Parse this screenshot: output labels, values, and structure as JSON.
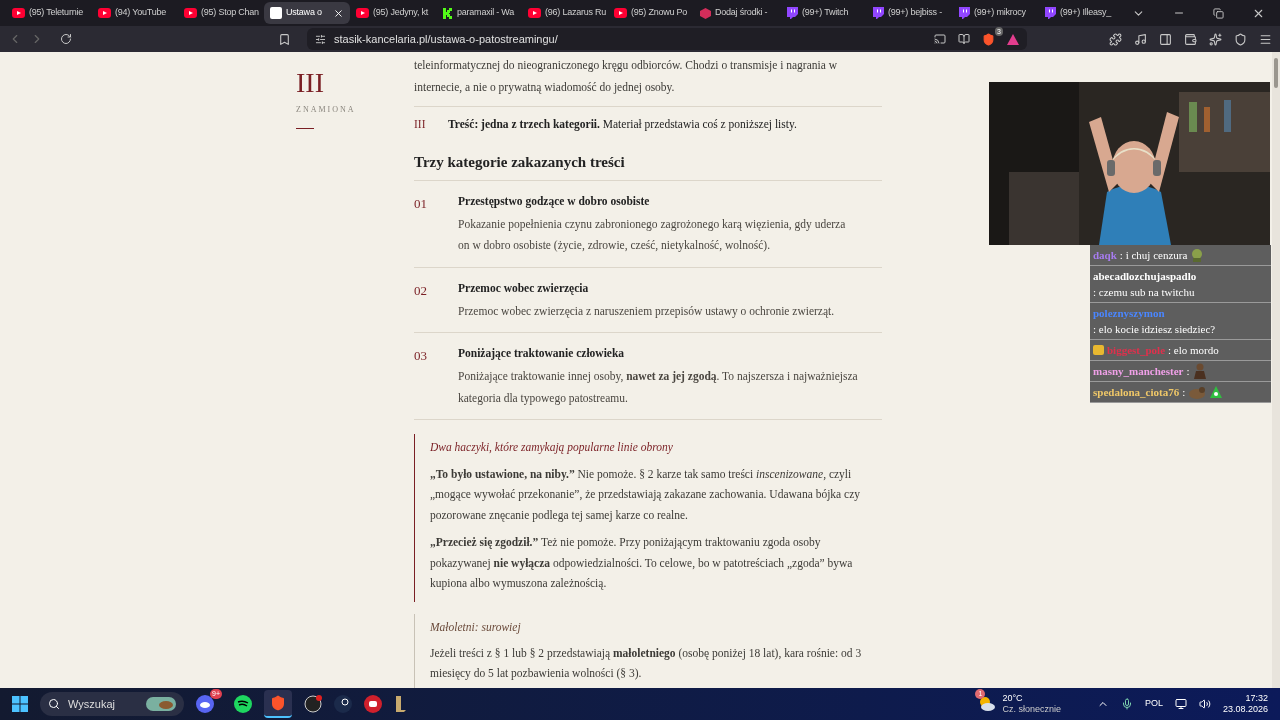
{
  "browser": {
    "tabs": [
      {
        "label": "(95) Teleturnie",
        "kind": "youtube",
        "selected": false
      },
      {
        "label": "(94) YouTube",
        "kind": "youtube",
        "selected": false
      },
      {
        "label": "(95) Stop Chan",
        "kind": "youtube",
        "selected": false
      },
      {
        "label": "Ustawa o",
        "kind": "page",
        "selected": true
      },
      {
        "label": "(95) Jedyny, kt",
        "kind": "youtube",
        "selected": false
      },
      {
        "label": "paramaxil - Wa",
        "kind": "kick",
        "selected": false
      },
      {
        "label": "(96) Lazarus Ru",
        "kind": "youtube",
        "selected": false
      },
      {
        "label": "(95) Znowu Po",
        "kind": "youtube",
        "selected": false
      },
      {
        "label": "Dodaj środki -",
        "kind": "wallet",
        "selected": false
      },
      {
        "label": "(99+) Twitch",
        "kind": "twitch",
        "selected": false
      },
      {
        "label": "(99+) bejbiss -",
        "kind": "twitch",
        "selected": false
      },
      {
        "label": "(99+) mikrocy",
        "kind": "twitch",
        "selected": false
      },
      {
        "label": "(99+) Illeasy_",
        "kind": "twitch",
        "selected": false
      }
    ],
    "url": "stasik-kancelaria.pl/ustawa-o-patostreamingu/",
    "shield_badge": "3"
  },
  "page": {
    "numeral": "III",
    "section_label": "ZNAMIONA",
    "intro": "teleinformatycznej do nieograniczonego kręgu odbiorców. Chodzi o transmisje i nagrania w internecie, a nie o prywatną wiadomość do jednej osoby.",
    "criterion": {
      "number": "III",
      "text": "**Treść: jedna z trzech kategorii.** Materiał przedstawia coś z poniższej listy."
    },
    "heading": "Trzy kategorie zakazanych treści",
    "categories": [
      {
        "number": "01",
        "title": "Przestępstwo godzące w dobro osobiste",
        "description": "Pokazanie popełnienia czynu zabronionego zagrożonego karą więzienia, gdy uderza on w dobro osobiste (życie, zdrowie, cześć, nietykalność, wolność)."
      },
      {
        "number": "02",
        "title": "Przemoc wobec zwierzęcia",
        "description": "Przemoc wobec zwierzęcia z naruszeniem przepisów ustawy o ochronie zwierząt."
      },
      {
        "number": "03",
        "title": "Poniżające traktowanie człowieka",
        "description": "Poniżające traktowanie innej osoby, **nawet za jej zgodą**. To najszersza i najważniejsza kategoria dla typowego patostreamu."
      }
    ],
    "callouts": [
      {
        "kind": "warning",
        "title": "Dwa haczyki, które zamykają popularne linie obrony",
        "paragraphs": [
          "**„To było ustawione, na niby.”** Nie pomoże. § 2 karze tak samo treści *inscenizowane*, czyli „mogące wywołać przekonanie”, że przedstawiają zakazane zachowania. Udawana bójka czy pozorowane znęcanie podlega tej samej karze co realne.",
          "**„Przecież się zgodził.”** Też nie pomoże. Przy poniżającym traktowaniu zgoda osoby pokazywanej **nie wyłącza** odpowiedzialności. To celowe, bo w patotreściach „zgoda” bywa kupiona albo wymuszona zależnością."
        ]
      },
      {
        "kind": "note",
        "title": "Małoletni: surowiej",
        "paragraphs": [
          "Jeżeli treści z § 1 lub § 2 przedstawiają **małoletniego** (osobę poniżej 18 lat), kara rośnie: od 3 miesięcy do 5 lat pozbawienia wolności (§ 3)."
        ]
      }
    ]
  },
  "stream": {
    "chat": [
      {
        "user": "daqk",
        "color": "#a77cf0",
        "text": ": i chuj cenzura",
        "badge": false,
        "emotes": [
          {
            "kind": "frog"
          }
        ]
      },
      {
        "user": "abecadlozchujaspadlo",
        "color": "#ffffff",
        "text": ": czemu sub na twitchu",
        "badge": false
      },
      {
        "user": "poleznyszymon",
        "color": "#4a86ff",
        "text": ": elo kocie idziesz siedziec?",
        "badge": false
      },
      {
        "user": "biggest_pole",
        "color": "#e0304c",
        "text": ": elo mordo",
        "badge": true
      },
      {
        "user": "masny_manchester",
        "color": "#f0a0e8",
        "text": ":",
        "badge": false,
        "emotes": [
          {
            "kind": "figure"
          }
        ]
      },
      {
        "user": "spedalona_ciota76",
        "color": "#f0c868",
        "text": ":",
        "badge": false,
        "emotes": [
          {
            "kind": "animal"
          },
          {
            "kind": "green"
          }
        ]
      }
    ]
  },
  "taskbar": {
    "search_placeholder": "Wyszukaj",
    "discord_badge": "9+",
    "weather_badge": "1",
    "temperature": "20°C",
    "weather": "Cz. słonecznie",
    "language": "POL",
    "time": "17:32",
    "date": "23.08.2026"
  }
}
